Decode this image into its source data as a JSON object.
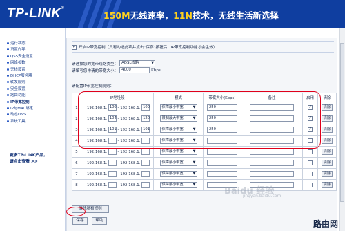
{
  "header": {
    "logo": "TP-LINK",
    "logo_reg": "®",
    "slogan_hl1": "150M",
    "slogan_part1": "无线速率，",
    "slogan_hl2": "11N",
    "slogan_part2": "技术，无线生活新选择"
  },
  "sidebar": {
    "items": [
      {
        "label": "运行状态",
        "active": false
      },
      {
        "label": "设置向导",
        "active": false
      },
      {
        "label": "QSS安全设置",
        "active": false
      },
      {
        "label": "网络参数",
        "active": false
      },
      {
        "label": "无线设置",
        "active": false
      },
      {
        "label": "DHCP服务器",
        "active": false
      },
      {
        "label": "转发规则",
        "active": false
      },
      {
        "label": "安全设置",
        "active": false
      },
      {
        "label": "路由功能",
        "active": false
      },
      {
        "label": "IP带宽控制",
        "active": true
      },
      {
        "label": "IP与MAC绑定",
        "active": false
      },
      {
        "label": "动态DNS",
        "active": false
      },
      {
        "label": "系统工具",
        "active": false
      }
    ],
    "more_line1": "更多TP-LINK产品，",
    "more_line2": "请点击查看 >>"
  },
  "main": {
    "enable_label": "开启IP带宽控制（只有勾选此项并点击“保存”按钮后，IP带宽控制功能才会生效）",
    "enable_checked": true,
    "line_type_label": "请选择您的宽带线路类型：",
    "line_type_value": "ADSL线路",
    "bandwidth_label": "请填写您申请的带宽大小：",
    "bandwidth_value": "4000",
    "bandwidth_unit": "Kbps",
    "rules_label": "请配置IP带宽控制规则：",
    "columns": [
      "",
      "IP地址段",
      "模式",
      "带宽大小(Kbps)",
      "备注",
      "启用",
      "清除"
    ],
    "ip_prefix": "192.168.1.",
    "ip_sep": "- 192.168.1.",
    "rows": [
      {
        "num": "1",
        "ip_start": "100",
        "ip_end": "100",
        "mode": "保障最小带宽",
        "bandwidth": "250",
        "note": "",
        "enabled": true,
        "clear": "清除"
      },
      {
        "num": "2",
        "ip_start": "104",
        "ip_end": "120",
        "mode": "限制最大带宽",
        "bandwidth": "250",
        "note": "",
        "enabled": true,
        "clear": "清除"
      },
      {
        "num": "3",
        "ip_start": "101",
        "ip_end": "101",
        "mode": "保障最小带宽",
        "bandwidth": "250",
        "note": "",
        "enabled": true,
        "clear": "清除"
      },
      {
        "num": "4",
        "ip_start": "",
        "ip_end": "",
        "mode": "保障最小带宽",
        "bandwidth": "",
        "note": "",
        "enabled": false,
        "clear": "清除"
      },
      {
        "num": "5",
        "ip_start": "",
        "ip_end": "",
        "mode": "保障最小带宽",
        "bandwidth": "",
        "note": "",
        "enabled": false,
        "clear": "清除"
      },
      {
        "num": "6",
        "ip_start": "",
        "ip_end": "",
        "mode": "保障最小带宽",
        "bandwidth": "",
        "note": "",
        "enabled": false,
        "clear": "清除"
      },
      {
        "num": "7",
        "ip_start": "",
        "ip_end": "",
        "mode": "保障最小带宽",
        "bandwidth": "",
        "note": "",
        "enabled": false,
        "clear": "清除"
      },
      {
        "num": "8",
        "ip_start": "",
        "ip_end": "",
        "mode": "保障最小带宽",
        "bandwidth": "",
        "note": "",
        "enabled": false,
        "clear": "清除"
      }
    ],
    "clear_all_label": "清除所有规则",
    "save_label": "保存",
    "help_label": "帮助"
  },
  "watermark": {
    "text": "Baidu 经验",
    "url": "jingyan.baidu.com",
    "corner": "路由网"
  },
  "colors": {
    "header_bg": "#0f3ea0",
    "slogan_highlight": "#ffd21f",
    "annotation_red": "#e0001b"
  }
}
